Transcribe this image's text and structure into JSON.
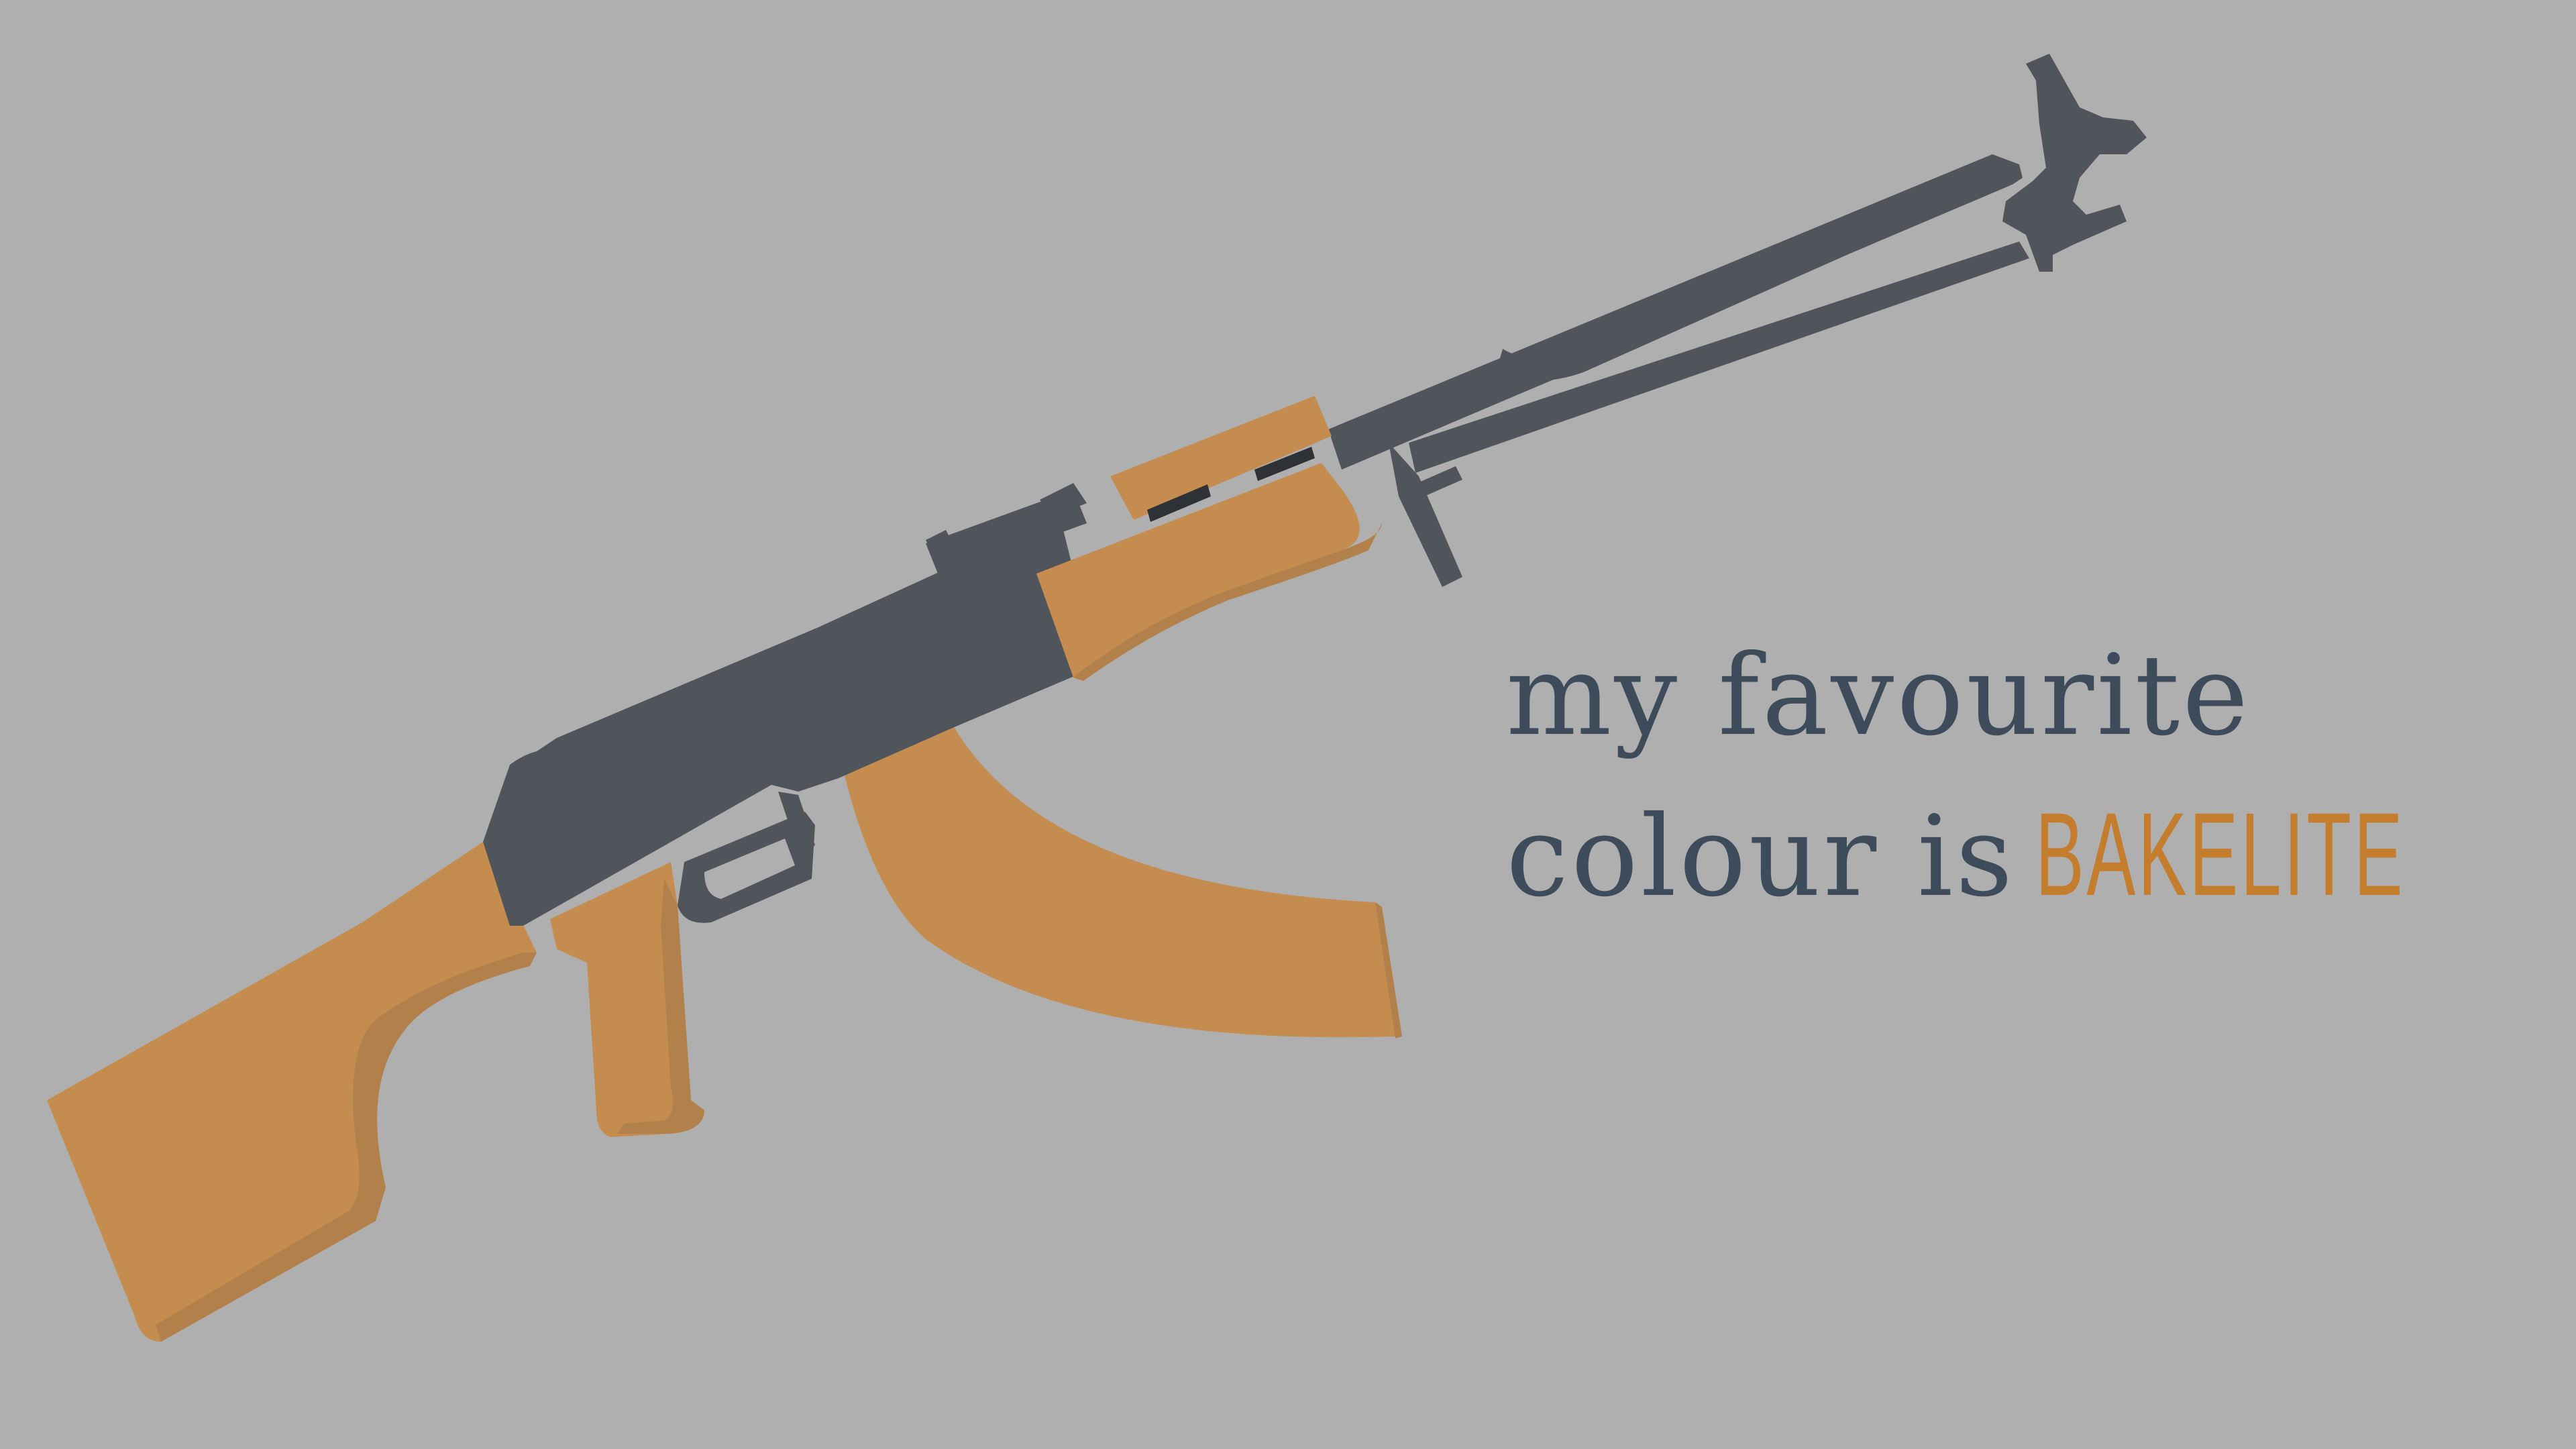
{
  "caption": {
    "line1": "my favourite",
    "line2_prefix": "colour is",
    "line2_highlight": "BAKELITE"
  },
  "colors": {
    "background": "#afafaf",
    "metal": "#50555b",
    "bakelite": "#c58c4f",
    "bakelite_shadow": "#b2804a",
    "text_dark": "#3d4b5a",
    "text_accent": "#c37d2c"
  },
  "illustration": {
    "subject": "rifle-icon"
  }
}
